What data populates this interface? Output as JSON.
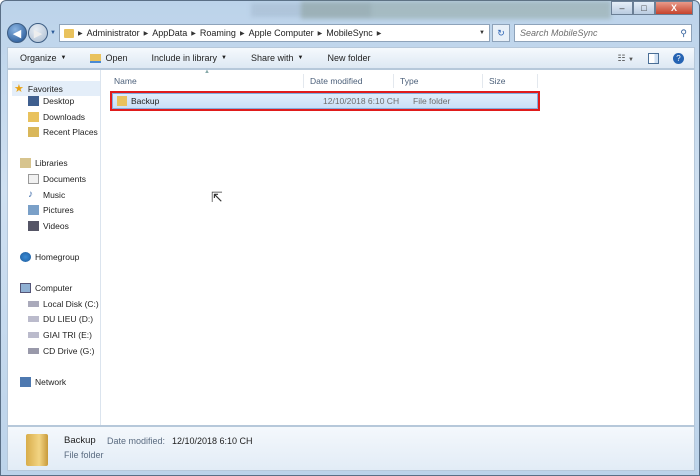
{
  "window": {
    "minimize": "–",
    "maximize": "□",
    "close": "X"
  },
  "address": {
    "crumbs": [
      "Administrator",
      "AppData",
      "Roaming",
      "Apple Computer",
      "MobileSync"
    ]
  },
  "search": {
    "placeholder": "Search MobileSync"
  },
  "toolbar": {
    "organize": "Organize",
    "open": "Open",
    "include": "Include in library",
    "share": "Share with",
    "new_folder": "New folder"
  },
  "sidebar": {
    "favorites": "Favorites",
    "desktop": "Desktop",
    "downloads": "Downloads",
    "recent": "Recent Places",
    "libraries": "Libraries",
    "documents": "Documents",
    "music": "Music",
    "pictures": "Pictures",
    "videos": "Videos",
    "homegroup": "Homegroup",
    "computer": "Computer",
    "local_disk": "Local Disk (C:)",
    "du_lieu": "DU LIEU (D:)",
    "giai_tri": "GIAI TRI (E:)",
    "cd_drive": "CD Drive (G:)",
    "network": "Network"
  },
  "columns": {
    "name": "Name",
    "date": "Date modified",
    "type": "Type",
    "size": "Size"
  },
  "files": [
    {
      "name": "Backup",
      "date": "12/10/2018 6:10 CH",
      "type": "File folder",
      "size": ""
    }
  ],
  "details": {
    "name": "Backup",
    "date_label": "Date modified:",
    "date": "12/10/2018 6:10 CH",
    "type": "File folder"
  }
}
